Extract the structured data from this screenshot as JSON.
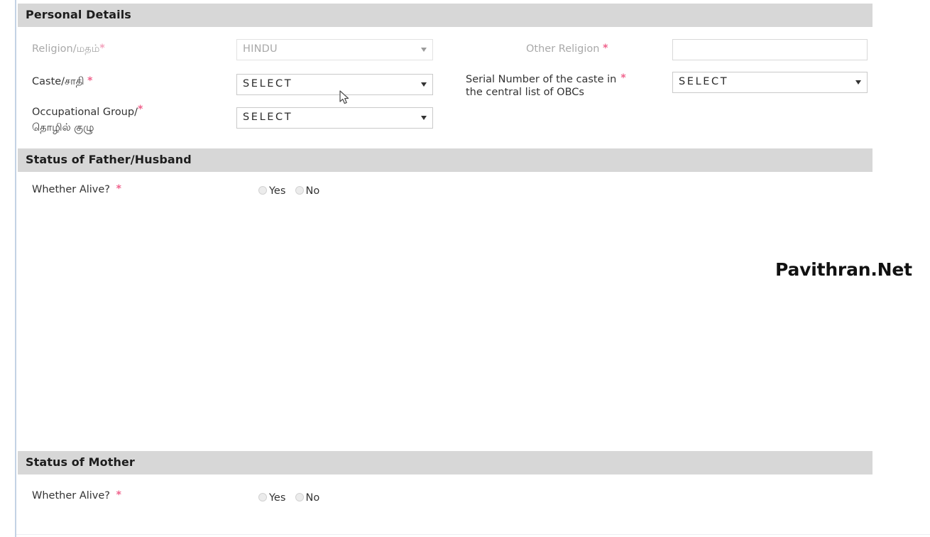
{
  "sections": [
    {
      "id": "personal",
      "title": "Personal Details"
    },
    {
      "id": "father",
      "title": "Status of Father/Husband"
    },
    {
      "id": "mother",
      "title": "Status of Mother"
    }
  ],
  "personal": {
    "religion": {
      "label": "Religion/மதம்",
      "required_mark": "*",
      "value": "HINDU",
      "disabled": true
    },
    "other_religion": {
      "label": "Other Religion",
      "required_mark": "*",
      "value": "",
      "placeholder": ""
    },
    "caste": {
      "label": "Caste/சாதி",
      "required_mark": "*",
      "value": "SELECT"
    },
    "serial_number": {
      "label_line1": "Serial Number of the caste in",
      "label_line2": "the central list of OBCs",
      "required_mark": "*",
      "value": "SELECT"
    },
    "occupational_group": {
      "label_line1": "Occupational Group/",
      "label_line2": "தொழில் குழு",
      "required_mark": "*",
      "value": "SELECT"
    }
  },
  "father_status": {
    "whether_alive": {
      "label": "Whether Alive?",
      "required_mark": "*",
      "options": [
        {
          "label": "Yes",
          "selected": false
        },
        {
          "label": "No",
          "selected": false
        }
      ]
    }
  },
  "mother_status": {
    "whether_alive": {
      "label": "Whether Alive?",
      "required_mark": "*",
      "options": [
        {
          "label": "Yes",
          "selected": false
        },
        {
          "label": "No",
          "selected": false
        }
      ]
    }
  },
  "watermark": {
    "text": "Pavithran.Net"
  },
  "colors": {
    "section_bar": "#d7d7d7",
    "required_asterisk": "#f0628c",
    "left_rule": "#c3d2e4",
    "select_border": "#c9c9c9",
    "disabled_text": "#a9a9a9",
    "body_text": "#333333"
  }
}
